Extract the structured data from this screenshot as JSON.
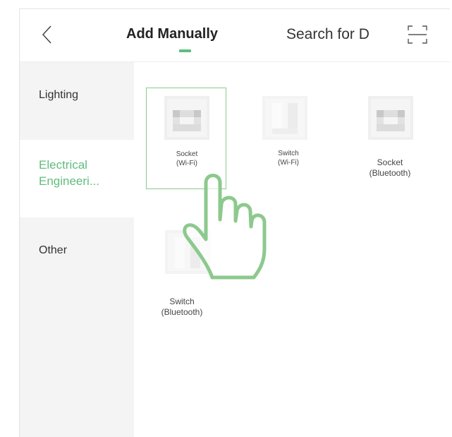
{
  "header": {
    "tabs": [
      {
        "label": "Add Manually",
        "active": true
      },
      {
        "label": "Search for D",
        "active": false
      }
    ],
    "back_icon": "chevron-left-icon",
    "scan_icon": "scan-icon"
  },
  "sidebar": {
    "items": [
      {
        "label": "Lighting",
        "active": false
      },
      {
        "label": "Electrical Engineeri...",
        "line1": "Electrical",
        "line2": "Engineeri...",
        "active": true
      },
      {
        "label": "Other",
        "active": false
      }
    ]
  },
  "devices": [
    {
      "line1": "Socket",
      "line2": "(Wi-Fi)",
      "selected": true
    },
    {
      "line1": "Switch",
      "line2": "(Wi-Fi)",
      "selected": false
    },
    {
      "line1": "Socket",
      "line2": "(Bluetooth)",
      "selected": false
    },
    {
      "line1": "Switch",
      "line2": "(Bluetooth)",
      "selected": false
    }
  ],
  "colors": {
    "accent": "#5fbd7f",
    "sidebar_bg": "#f4f4f4",
    "hand_stroke": "#8cc98d"
  }
}
